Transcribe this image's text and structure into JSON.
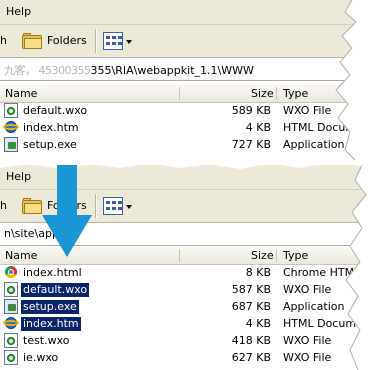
{
  "top": {
    "menu": {
      "help": "Help"
    },
    "toolbar": {
      "search_partial": "h",
      "folders_label": "Folders"
    },
    "address": {
      "blurred_prefix": "九客， 45300355",
      "path": "355\\RIA\\webappkit_1.1\\WWW"
    },
    "columns": {
      "name": "Name",
      "size": "Size",
      "type": "Type"
    },
    "files": [
      {
        "name": "default.wxo",
        "size": "589 KB",
        "type": "WXO File",
        "icon": "wxo-file-icon"
      },
      {
        "name": "index.htm",
        "size": "4 KB",
        "type": "HTML Documen",
        "icon": "ie-icon"
      },
      {
        "name": "setup.exe",
        "size": "727 KB",
        "type": "Application",
        "icon": "exe-icon"
      }
    ]
  },
  "bottom": {
    "menu": {
      "help": "Help"
    },
    "toolbar": {
      "search_partial": "h",
      "folders_label": "Folders"
    },
    "address": {
      "path": "n\\site\\app"
    },
    "columns": {
      "name": "Name",
      "size": "Size",
      "type": "Type"
    },
    "files": [
      {
        "name": "index.html",
        "size": "8 KB",
        "type": "Chrome HTML",
        "icon": "chrome-icon",
        "selected": false
      },
      {
        "name": "default.wxo",
        "size": "587 KB",
        "type": "WXO File",
        "icon": "wxo-file-icon",
        "selected": true
      },
      {
        "name": "setup.exe",
        "size": "687 KB",
        "type": "Application",
        "icon": "exe-icon",
        "selected": true
      },
      {
        "name": "index.htm",
        "size": "4 KB",
        "type": "HTML Document",
        "icon": "ie-icon",
        "selected": true
      },
      {
        "name": "test.wxo",
        "size": "418 KB",
        "type": "WXO File",
        "icon": "wxo-file-icon",
        "selected": false
      },
      {
        "name": "ie.wxo",
        "size": "627 KB",
        "type": "WXO File",
        "icon": "wxo-file-icon",
        "selected": false
      }
    ]
  },
  "colors": {
    "selection": "#0a246a",
    "arrow": "#1a96d4",
    "chrome": "#ece9d8"
  },
  "decor": {
    "transition_arrow": "down-arrow-icon"
  }
}
